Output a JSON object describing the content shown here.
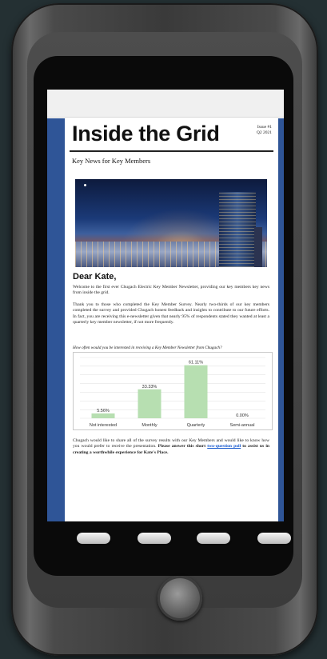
{
  "newsletter": {
    "title": "Inside the Grid",
    "issue_line1": "Issue #1",
    "issue_line2": "Q2 2021",
    "tagline": "Key News for Key Members",
    "greeting": "Dear Kate,",
    "paragraph1": "Welcome to the first ever Chugach Electric Key Member Newsletter, providing our key members key news from inside the grid.",
    "paragraph2": "Thank you to those who completed the Key Member Survey. Nearly two-thirds of our key members completed the survey and provided Chugach honest feedback and insights to contribute to our future efforts. In fact, you are receiving this e-newsletter given that nearly 95% of respondents stated they wanted at least a quarterly key member newsletter, if not more frequently.",
    "paragraph3_start": "Chugach would like to share all of the survey results with our Key Members and would like to know how you would prefer to receive the presentation. ",
    "paragraph3_bold": "Please answer this short ",
    "poll_link": "two-question poll",
    "paragraph3_end": " to assist us in creating a worthwhile experience for Kate's Place."
  },
  "chart_data": {
    "type": "bar",
    "title": "How often would you be interested in receiving a Key Member Newsletter from Chugach?",
    "categories": [
      "Not interested",
      "Monthly",
      "Quarterly",
      "Semi-annual"
    ],
    "values": [
      5.56,
      33.33,
      61.11,
      0.0
    ],
    "value_labels": [
      "5.56%",
      "33.33%",
      "61.11%",
      "0.00%"
    ],
    "ylim": [
      0,
      70
    ],
    "grid": true,
    "bar_color": "#b7dfb1"
  },
  "colors": {
    "doc_background": "#2f5597",
    "link": "#1155cc"
  }
}
